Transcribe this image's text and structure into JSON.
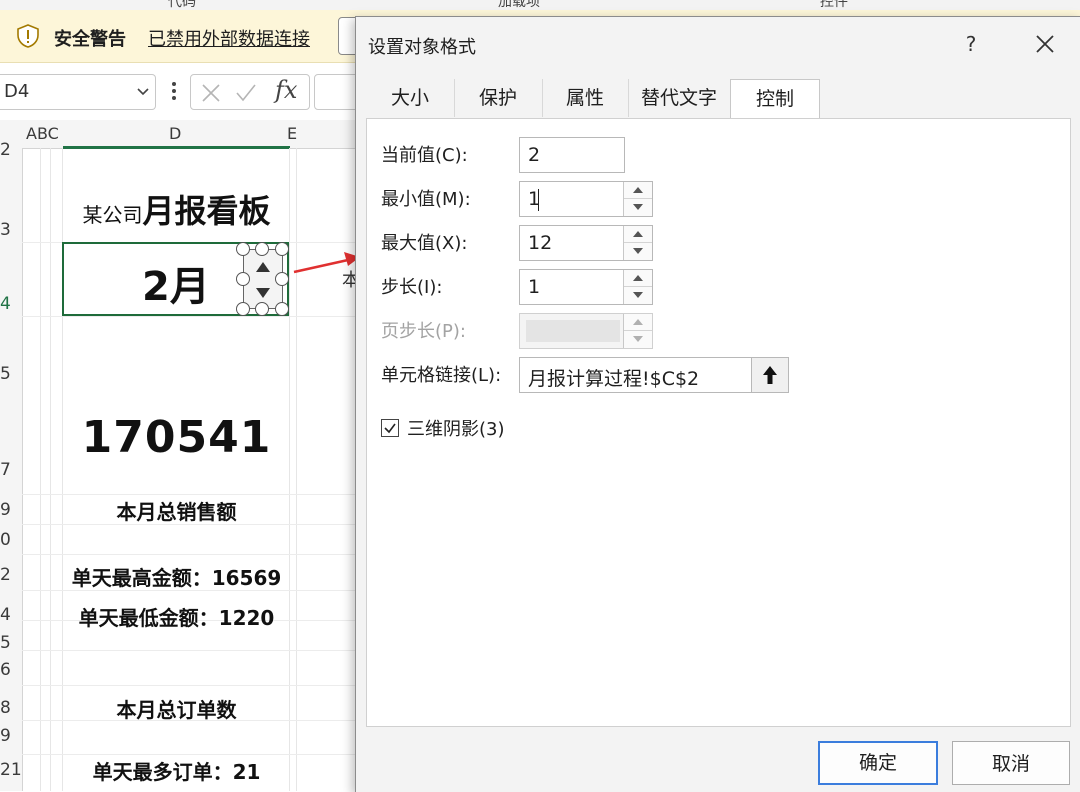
{
  "ribbon": {
    "partial_labels": [
      "代码",
      "加载项",
      "控件"
    ]
  },
  "security_bar": {
    "title": "安全警告",
    "link": "已禁用外部数据连接"
  },
  "formula_bar": {
    "name_box": "D4",
    "fx_label": "fx"
  },
  "sheet": {
    "columns": [
      "ABC",
      "D",
      "E"
    ],
    "rows": [
      "2",
      "3",
      "4",
      "5",
      "7",
      "9",
      "0",
      "2",
      "4",
      "5",
      "6",
      "8",
      "9",
      "21"
    ],
    "dashboard": {
      "title_prefix": "某公司",
      "title_main": "月报看板",
      "month": "2月",
      "total_sales": "170541",
      "total_sales_label": "本月总销售额",
      "max_amount": "单天最高金额：16569",
      "min_amount": "单天最低金额：1220",
      "total_orders_label": "本月总订单数",
      "max_orders": "单天最多订单：21"
    },
    "behind_dialog_char": "本"
  },
  "dialog": {
    "title": "设置对象格式",
    "help": "?",
    "tabs": [
      "大小",
      "保护",
      "属性",
      "替代文字",
      "控制"
    ],
    "active_tab": "控制",
    "fields": {
      "current_value": {
        "label": "当前值(C):",
        "value": "2"
      },
      "min_value": {
        "label": "最小值(M):",
        "value": "1"
      },
      "max_value": {
        "label": "最大值(X):",
        "value": "12"
      },
      "step": {
        "label": "步长(I):",
        "value": "1"
      },
      "page_step": {
        "label": "页步长(P):",
        "value": ""
      },
      "cell_link": {
        "label": "单元格链接(L):",
        "value": "月报计算过程!$C$2"
      }
    },
    "shading_3d": {
      "label": "三维阴影(3)",
      "checked": true
    },
    "ok": "确定",
    "cancel": "取消"
  }
}
